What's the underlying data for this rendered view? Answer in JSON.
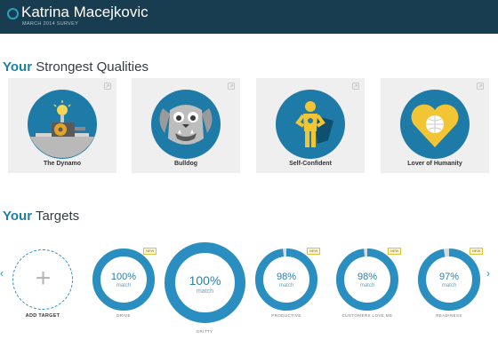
{
  "header": {
    "name": "Katrina Macejkovic",
    "subtitle": "MARCH 2014 SURVEY"
  },
  "qualities": {
    "title_bold": "Your",
    "title_rest": "Strongest Qualities",
    "cards": [
      {
        "label": "The Dynamo"
      },
      {
        "label": "Bulldog"
      },
      {
        "label": "Self-Confident"
      },
      {
        "label": "Lover of Humanity"
      }
    ]
  },
  "targets": {
    "title_bold": "Your",
    "title_rest": "Targets",
    "add_label": "ADD TARGET",
    "add_symbol": "+",
    "items": [
      {
        "pct": "100%",
        "match": "match",
        "label": "DRIVE",
        "badge": "NEW",
        "fraction": 1.0
      },
      {
        "pct": "100%",
        "match": "match",
        "label": "GRITTY",
        "badge": "",
        "fraction": 1.0
      },
      {
        "pct": "98%",
        "match": "match",
        "label": "PRODUCTIVE",
        "badge": "NEW",
        "fraction": 0.98
      },
      {
        "pct": "98%",
        "match": "match",
        "label": "CUSTOMERS LOVE ME",
        "badge": "NEW",
        "fraction": 0.98
      },
      {
        "pct": "97%",
        "match": "match",
        "label": "READINESS",
        "badge": "NEW",
        "fraction": 0.97
      }
    ]
  },
  "nav": {
    "prev": "‹",
    "next": "›"
  },
  "colors": {
    "header": "#183d50",
    "accent": "#1f7fa5",
    "ring": "#2a8fc0",
    "card_bg": "#efefef"
  }
}
